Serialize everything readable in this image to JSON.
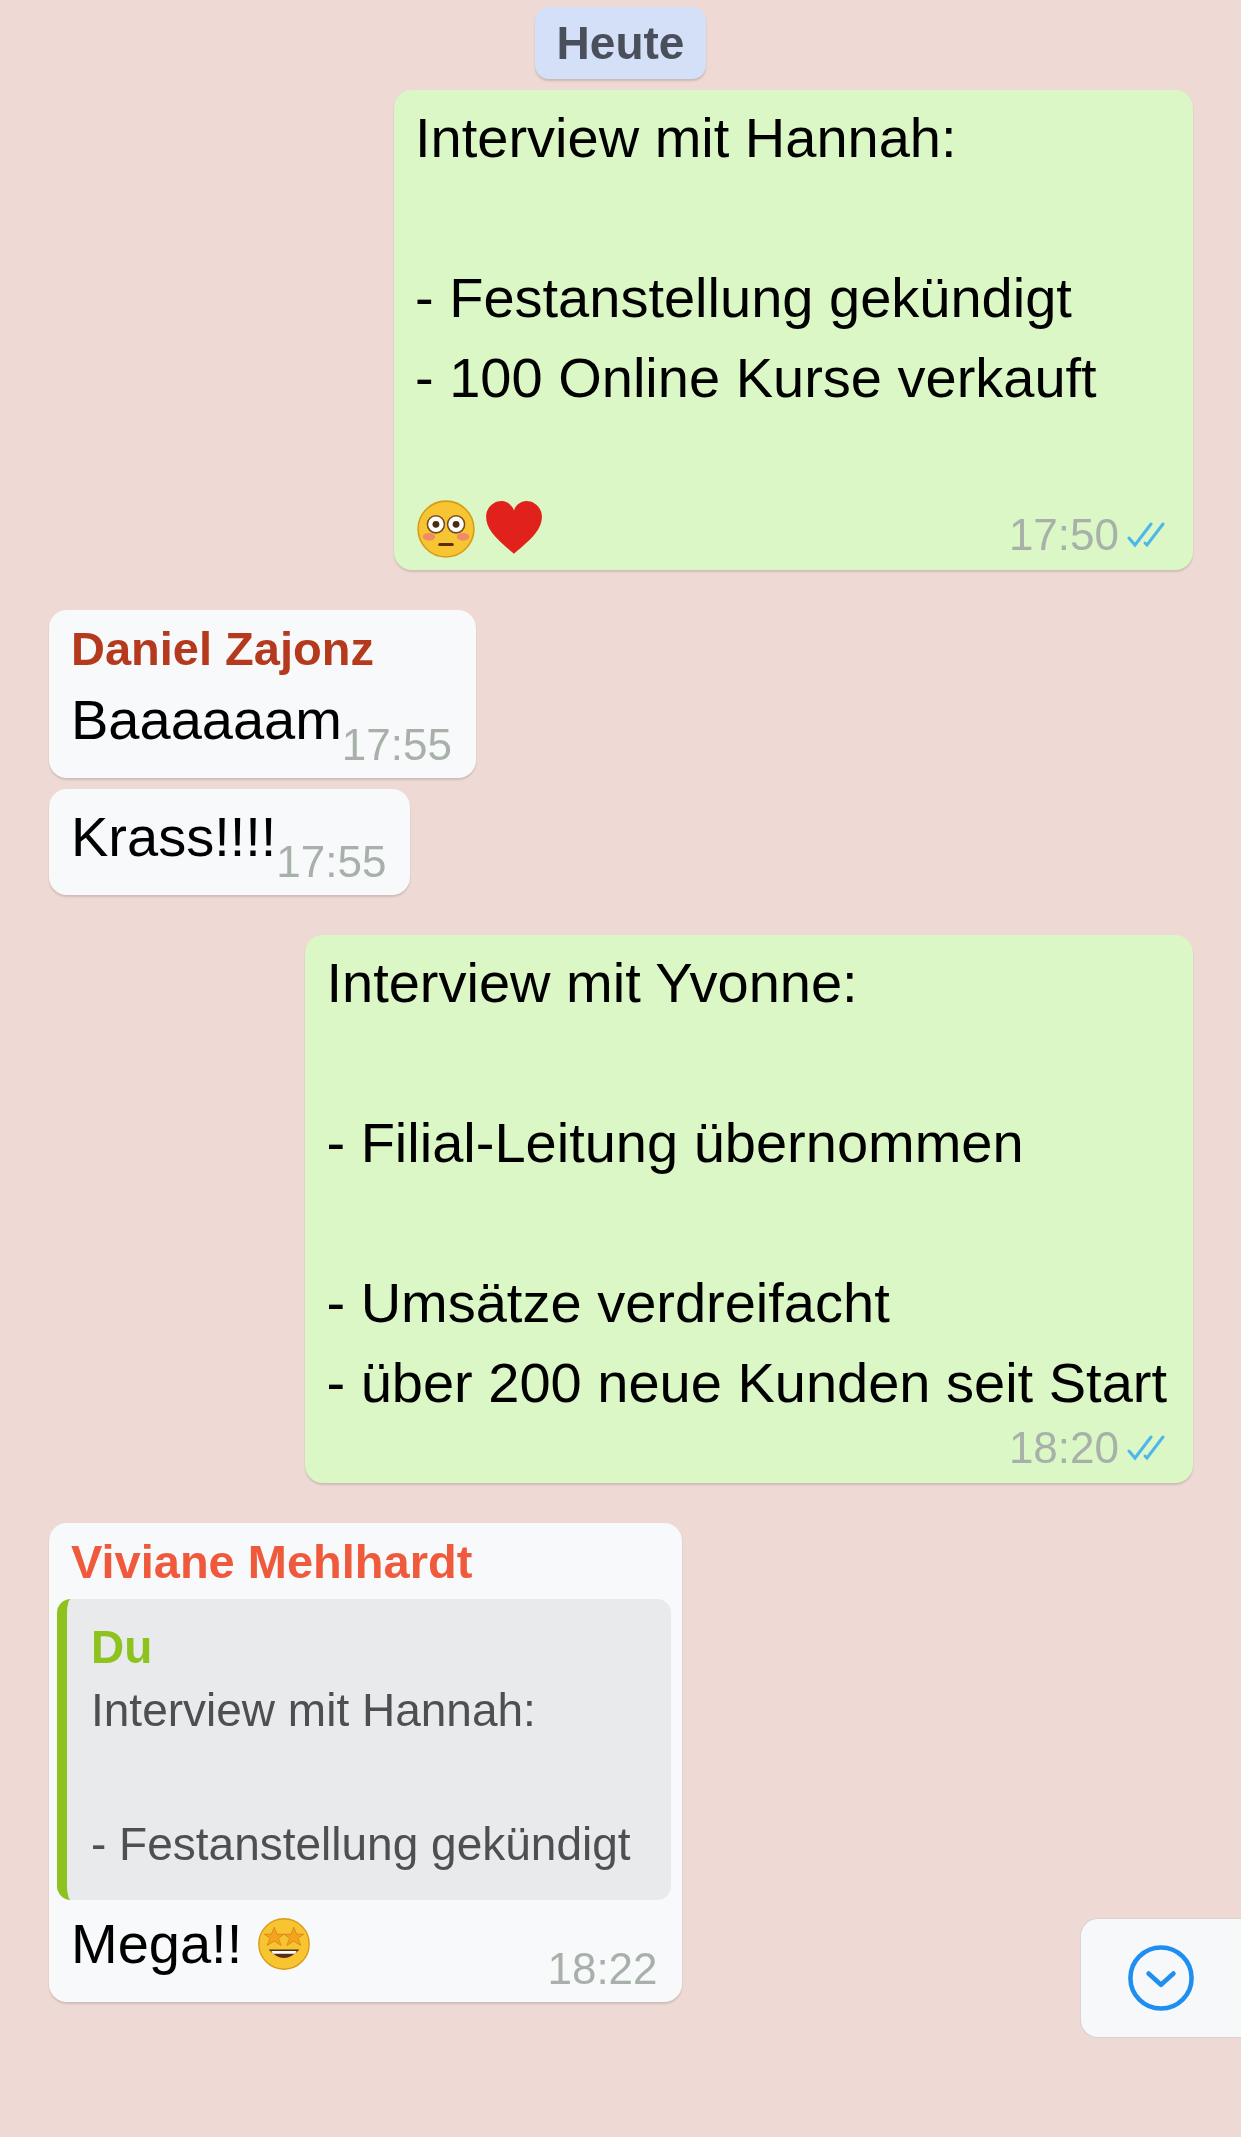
{
  "date_chip": "Heute",
  "messages": [
    {
      "kind": "outgoing",
      "text": "Interview mit Hannah:\n\n- Festanstellung gekündigt\n- 100 Online Kurse verkauft",
      "emojis": [
        {
          "kind": "flushed"
        },
        {
          "kind": "heart"
        }
      ],
      "time": "17:50",
      "read": true
    },
    {
      "kind": "incoming",
      "sender": "Daniel Zajonz",
      "color": "#b5391c",
      "text": "Baaaaaam",
      "time": "17:55"
    },
    {
      "kind": "incoming",
      "text": "Krass!!!!",
      "time": "17:55"
    },
    {
      "kind": "outgoing",
      "text": "Interview mit Yvonne:\n\n- Filial-Leitung übernommen\n\n- Umsätze verdreifacht\n- über 200 neue Kunden seit Start",
      "time": "18:20",
      "read": true
    },
    {
      "kind": "incoming",
      "sender": "Viviane Mehlhardt",
      "color": "#f05a3c",
      "quote": {
        "author": "Du",
        "text": "Interview mit Hannah:\n\n- Festanstellung gekündigt"
      },
      "text": "Mega!!",
      "emojis": [
        {
          "kind": "starstruck"
        }
      ],
      "time": "18:22"
    }
  ],
  "scroll_down_button": {
    "kind": "chevron"
  }
}
